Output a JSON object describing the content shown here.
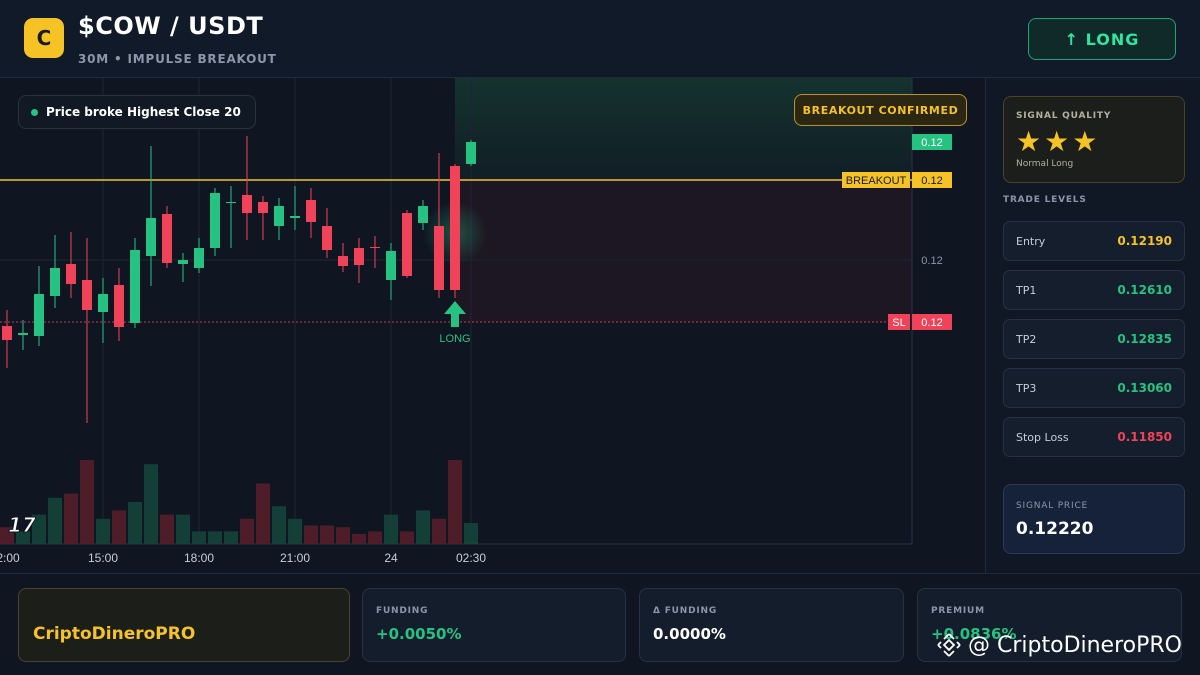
{
  "header": {
    "coin_logo_letter": "C",
    "title": "$COW / USDT",
    "subtitle": "30M • IMPULSE BREAKOUT",
    "long_button": "↑ LONG"
  },
  "chart": {
    "info_pill": "Price broke Highest Close 20",
    "breakout_badge": "BREAKOUT CONFIRMED",
    "labels": {
      "current_price": "0.12",
      "breakout_tag": "BREAKOUT",
      "breakout_price": "0.12",
      "axis_price": "0.12",
      "sl_tag": "SL",
      "sl_price": "0.12",
      "long_marker": "LONG",
      "tv_logo": "17"
    },
    "time_ticks": [
      "2:00",
      "15:00",
      "18:00",
      "21:00",
      "24",
      "02:30"
    ],
    "colors": {
      "up": "#26c281",
      "down": "#f0435a",
      "breakout": "#f5c325",
      "sl": "#f0435a"
    }
  },
  "chart_data": {
    "type": "candlestick",
    "title": "",
    "x": [
      "2:00",
      "15:00",
      "18:00",
      "21:00",
      "24",
      "02:30"
    ],
    "breakout_level": 0.12,
    "stop_loss_level": 0.1185,
    "signal_marker": "LONG",
    "candles": [
      {
        "dir": "down",
        "volume_rel": 0.2
      },
      {
        "dir": "up",
        "volume_rel": 0.15
      },
      {
        "dir": "up",
        "volume_rel": 0.35
      },
      {
        "dir": "up",
        "volume_rel": 0.55
      },
      {
        "dir": "down",
        "volume_rel": 0.6
      },
      {
        "dir": "down",
        "volume_rel": 1.0
      },
      {
        "dir": "up",
        "volume_rel": 0.3
      },
      {
        "dir": "down",
        "volume_rel": 0.4
      },
      {
        "dir": "up",
        "volume_rel": 0.5
      },
      {
        "dir": "up",
        "volume_rel": 0.95
      },
      {
        "dir": "down",
        "volume_rel": 0.35
      },
      {
        "dir": "up",
        "volume_rel": 0.35
      },
      {
        "dir": "up",
        "volume_rel": 0.15
      },
      {
        "dir": "up",
        "volume_rel": 0.15
      },
      {
        "dir": "neutral",
        "volume_rel": 0.15
      },
      {
        "dir": "down",
        "volume_rel": 0.3
      },
      {
        "dir": "down",
        "volume_rel": 0.72
      },
      {
        "dir": "up",
        "volume_rel": 0.45
      },
      {
        "dir": "down",
        "volume_rel": 0.22
      },
      {
        "dir": "up",
        "volume_rel": 0.3
      },
      {
        "dir": "down",
        "volume_rel": 0.22
      },
      {
        "dir": "down",
        "volume_rel": 0.2
      },
      {
        "dir": "down",
        "volume_rel": 0.12
      },
      {
        "dir": "down",
        "volume_rel": 0.15
      },
      {
        "dir": "neutral",
        "volume_rel": 0.35
      },
      {
        "dir": "down",
        "volume_rel": 0.15
      },
      {
        "dir": "up",
        "volume_rel": 0.4
      },
      {
        "dir": "down",
        "volume_rel": 0.3
      },
      {
        "dir": "down",
        "volume_rel": 1.0
      },
      {
        "dir": "up",
        "volume_rel": 0.25
      },
      {
        "dir": "up",
        "volume_rel": 0.03
      }
    ]
  },
  "sidebar": {
    "quality_label": "SIGNAL QUALITY",
    "stars": "★★★",
    "quality_sub": "Normal Long",
    "levels_heading": "TRADE LEVELS",
    "levels": [
      {
        "name": "Entry",
        "value": "0.12190",
        "color": "#f5c325"
      },
      {
        "name": "TP1",
        "value": "0.12610",
        "color": "#26c281"
      },
      {
        "name": "TP2",
        "value": "0.12835",
        "color": "#26c281"
      },
      {
        "name": "TP3",
        "value": "0.13060",
        "color": "#26c281"
      },
      {
        "name": "Stop Loss",
        "value": "0.11850",
        "color": "#f0435a"
      }
    ],
    "signal_price_label": "SIGNAL PRICE",
    "signal_price": "0.12220"
  },
  "footer": {
    "brand": "CriptoDineroPRO",
    "stats": [
      {
        "label": "FUNDING",
        "value": "+0.0050%",
        "color": "#26c281"
      },
      {
        "label": "Δ FUNDING",
        "value": "0.0000%",
        "color": "#ffffff"
      },
      {
        "label": "PREMIUM",
        "value": "+0.0836%",
        "color": "#26c281"
      }
    ],
    "watermark": "@ CriptoDineroPRO"
  }
}
